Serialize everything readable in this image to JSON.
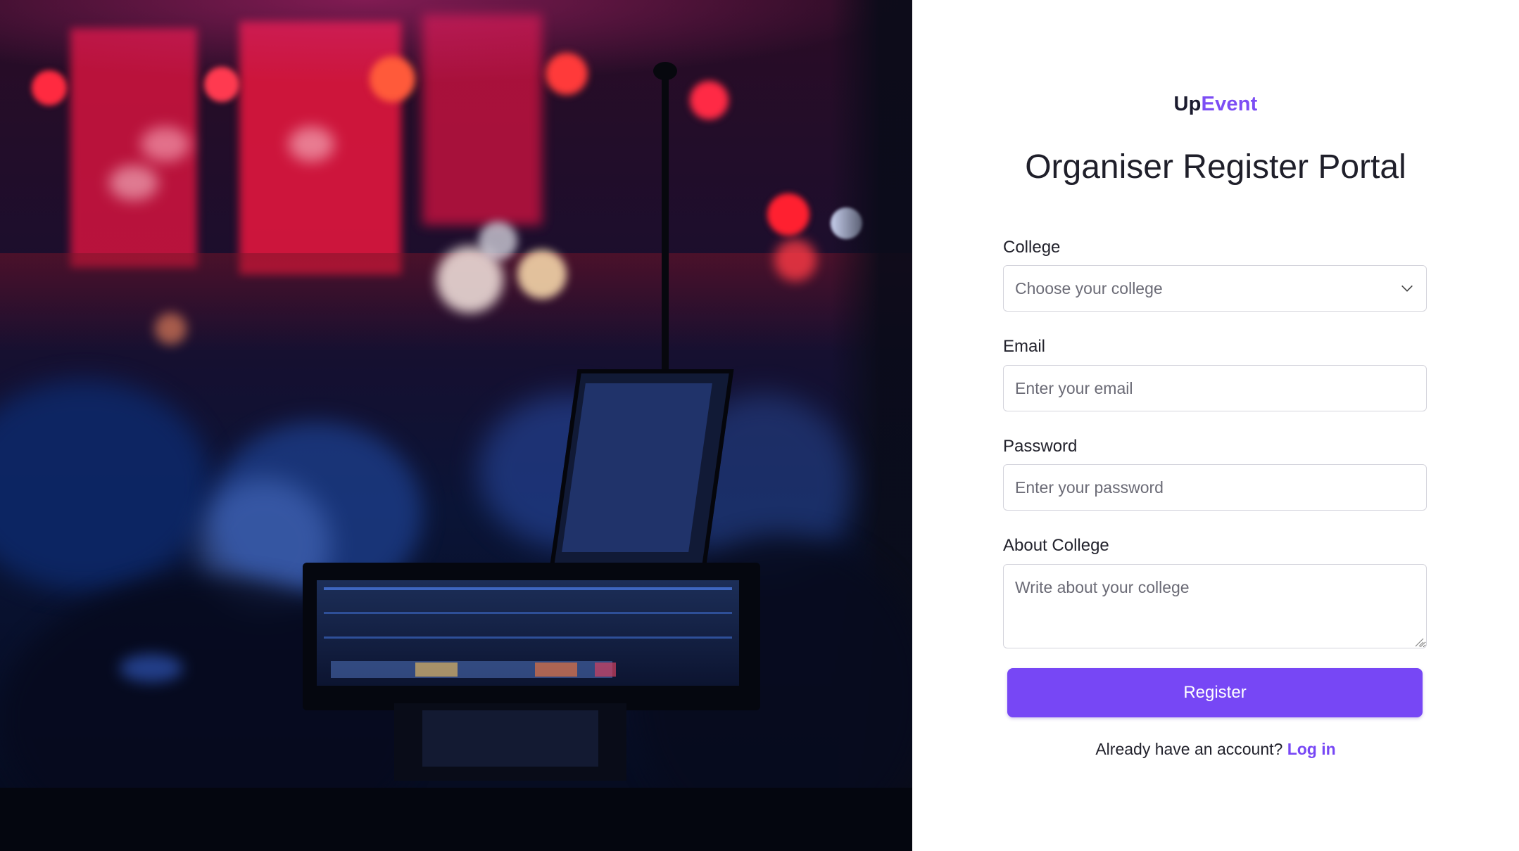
{
  "brand": {
    "part1": "Up",
    "part2": "Event"
  },
  "page_title": "Organiser Register Portal",
  "form": {
    "college": {
      "label": "College",
      "placeholder": "Choose your college"
    },
    "email": {
      "label": "Email",
      "placeholder": "Enter your email"
    },
    "password": {
      "label": "Password",
      "placeholder": "Enter your password"
    },
    "about": {
      "label": "About College",
      "placeholder": "Write about your college"
    },
    "submit_label": "Register"
  },
  "footer": {
    "prompt": "Already have an account?",
    "link_label": "Log in"
  },
  "colors": {
    "accent": "#7747f5",
    "brand_accent": "#7c4df4",
    "text": "#1f1f2a"
  },
  "icons": {
    "select_caret": "chevron-down-icon"
  }
}
